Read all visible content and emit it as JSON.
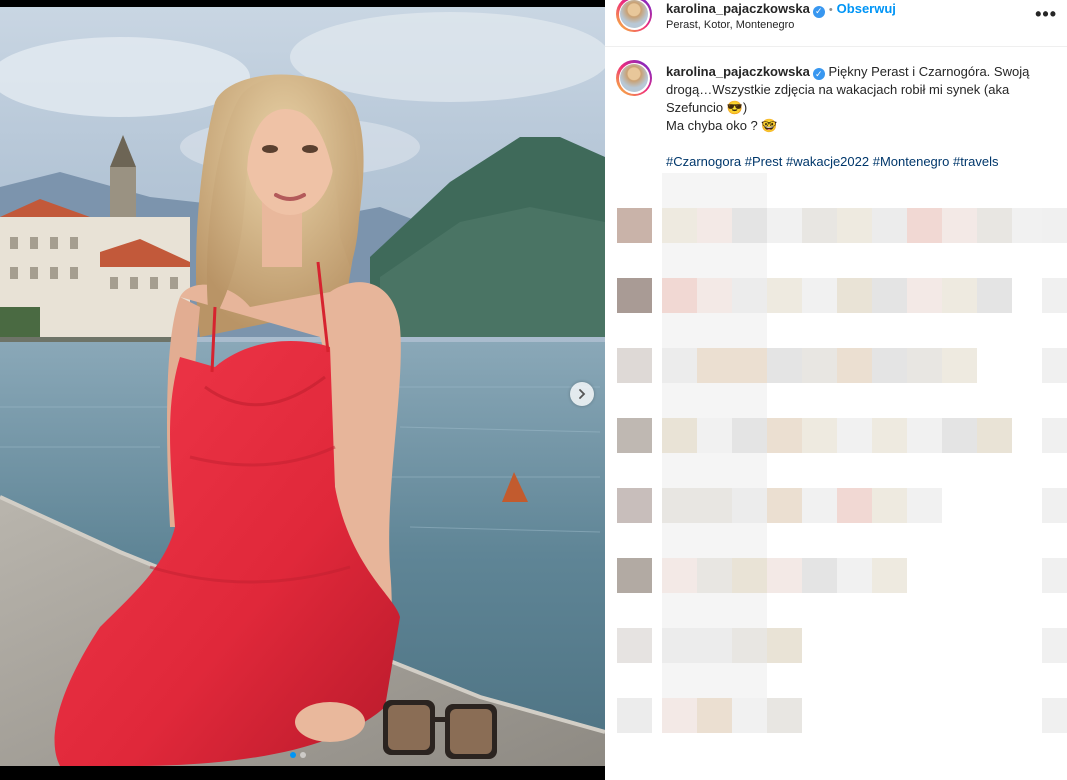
{
  "post": {
    "username": "karolina_pajaczkowska",
    "separator": "•",
    "follow_label": "Obserwuj",
    "location": "Perast, Kotor, Montenegro",
    "more_label": "•••"
  },
  "caption": {
    "username": "karolina_pajaczkowska",
    "line1": "Piękny Perast i Czarnogóra. Swoją drogą…Wszystkie zdjęcia na wakacjach robił mi synek (aka Szefuncio 😎)",
    "line2": "Ma chyba oko ? 🤓",
    "hashtags": [
      "#Czarnogora",
      "#Prest",
      "#wakacje2022",
      "#Montenegro",
      "#travels"
    ]
  },
  "icons": {
    "verified": "verified-badge-icon",
    "next": "chevron-right-icon",
    "more": "more-options-icon"
  },
  "colors": {
    "accent": "#0095f6",
    "verified": "#3897f0",
    "hashtag": "#00376b",
    "dress": "#e0283a"
  }
}
